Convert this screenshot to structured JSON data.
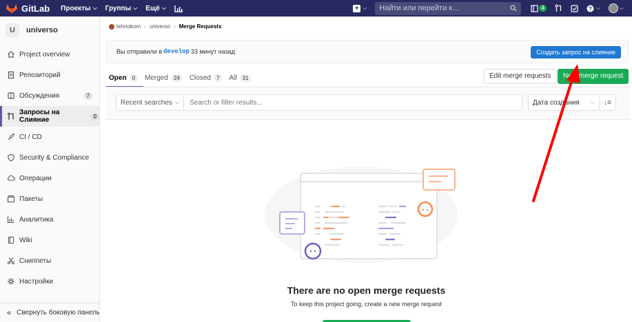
{
  "topbar": {
    "brand": "GitLab",
    "menus": [
      "Проекты",
      "Группы",
      "Ещё"
    ],
    "search_placeholder": "Найти или перейти к…",
    "todo_count": "4"
  },
  "sidebar": {
    "project_letter": "U",
    "project_name": "universo",
    "items": [
      {
        "label": "Project overview",
        "icon": "home-icon"
      },
      {
        "label": "Репозиторий",
        "icon": "doc-icon"
      },
      {
        "label": "Обсуждения",
        "icon": "issues-icon",
        "count": "7"
      },
      {
        "label": "Запросы на Слияние",
        "icon": "merge-request-icon",
        "count": "0"
      },
      {
        "label": "CI / CD",
        "icon": "rocket-icon"
      },
      {
        "label": "Security & Compliance",
        "icon": "shield-icon"
      },
      {
        "label": "Операции",
        "icon": "cloud-icon"
      },
      {
        "label": "Пакеты",
        "icon": "package-icon"
      },
      {
        "label": "Аналитика",
        "icon": "chart-icon"
      },
      {
        "label": "Wiki",
        "icon": "book-icon"
      },
      {
        "label": "Сниппеты",
        "icon": "scissors-icon"
      },
      {
        "label": "Настройки",
        "icon": "gear-icon"
      }
    ],
    "collapse_label": "Свернуть боковую панель"
  },
  "breadcrumb": {
    "group": "tehnokom",
    "project": "universo",
    "current": "Merge Requests"
  },
  "alert": {
    "prefix": "Вы отправили в",
    "branch": "develop",
    "suffix": "33 минут назад",
    "button": "Создать запрос на слияние"
  },
  "tabs": [
    {
      "label": "Open",
      "count": "0"
    },
    {
      "label": "Merged",
      "count": "24"
    },
    {
      "label": "Closed",
      "count": "7"
    },
    {
      "label": "All",
      "count": "31"
    }
  ],
  "actions": {
    "edit": "Edit merge requests",
    "new": "New merge request"
  },
  "filter": {
    "recent": "Recent searches",
    "placeholder": "Search or filter results...",
    "sort": "Дата создания"
  },
  "empty": {
    "title": "There are no open merge requests",
    "subtitle": "To keep this project going, create a new merge request"
  },
  "colors": {
    "navbar": "#292961",
    "accent": "#6666c4",
    "primary_green": "#1aaa55",
    "primary_blue": "#1f78d1",
    "annotation_arrow": "#ff0000"
  }
}
